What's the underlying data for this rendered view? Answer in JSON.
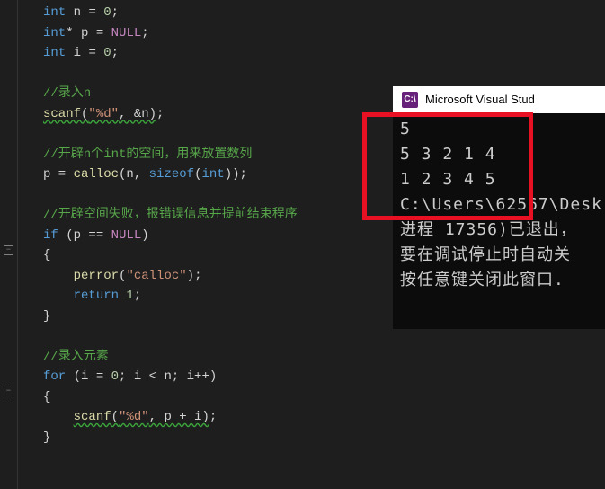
{
  "code": {
    "l1": {
      "kw1": "int",
      "var1": " n ",
      "op1": "=",
      "num1": " 0",
      "semi": ";"
    },
    "l2": {
      "kw1": "int",
      "star": "* p ",
      "op1": "=",
      "mac1": " NULL",
      "semi": ";"
    },
    "l3": {
      "kw1": "int",
      "var1": " i ",
      "op1": "=",
      "num1": " 0",
      "semi": ";"
    },
    "l5": {
      "cmt": "//录入n"
    },
    "l6": {
      "fn": "scanf",
      "p1": "(",
      "str": "\"%d\"",
      "arg": ", &n)",
      "semi": ";"
    },
    "l8": {
      "cmt": "//开辟n个int的空间，用来放置数列"
    },
    "l9": {
      "p1": "p = ",
      "fn": "calloc",
      "p2": "(n, ",
      "kw": "sizeof",
      "p3": "(",
      "kw2": "int",
      "p4": "))",
      "semi": ";"
    },
    "l11": {
      "cmt": "//开辟空间失败，报错误信息并提前结束程序"
    },
    "l12": {
      "kw": "if",
      "p1": " (p == ",
      "mac": "NULL",
      "p2": ")"
    },
    "l13": {
      "brace": "{"
    },
    "l14": {
      "fn": "perror",
      "p1": "(",
      "str": "\"calloc\"",
      "p2": ")",
      "semi": ";"
    },
    "l15": {
      "kw": "return",
      "num": " 1",
      "semi": ";"
    },
    "l16": {
      "brace": "}"
    },
    "l18": {
      "cmt": "//录入元素"
    },
    "l19": {
      "kw": "for",
      "p1": " (i = ",
      "num1": "0",
      "p2": "; i < n; i++)"
    },
    "l20": {
      "brace": "{"
    },
    "l21": {
      "fn": "scanf",
      "p1": "(",
      "str": "\"%d\"",
      "p2": ", p + i)",
      "semi": ";"
    },
    "l22": {
      "brace": "}"
    }
  },
  "console": {
    "titleIcon": "C:\\",
    "title": "Microsoft Visual Stud",
    "line1": "5",
    "line2": "5 3 2 1 4",
    "line3": "1 2 3 4 5",
    "line4": "C:\\Users\\62567\\Desk",
    "line5": "进程 17356)已退出，",
    "line6": "要在调试停止时自动关",
    "line7": "按任意键关闭此窗口."
  },
  "fold": {
    "minus": "−"
  }
}
